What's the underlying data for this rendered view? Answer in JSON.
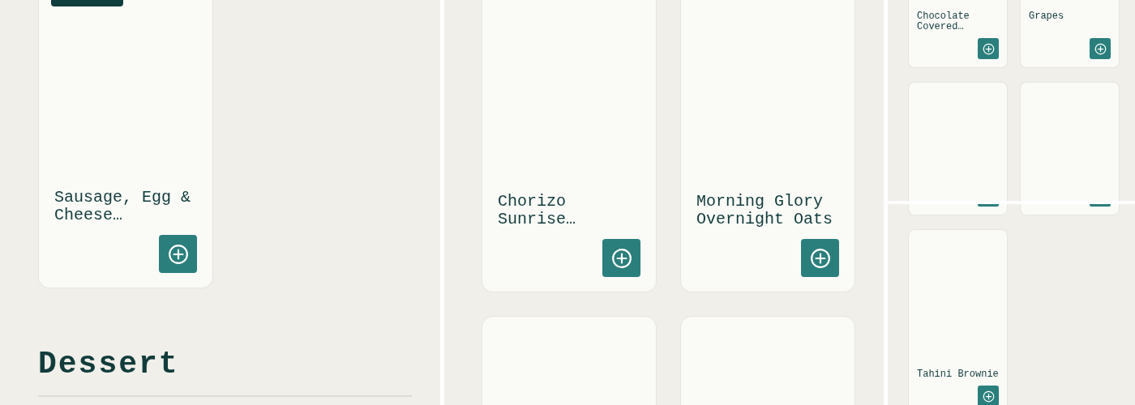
{
  "left_panel": {
    "card_title": "Sausage, Egg & Cheese…",
    "section_heading": "Dessert"
  },
  "middle_panel": {
    "card_titles": [
      "Chorizo Sunrise…",
      "Morning Glory Overnight Oats"
    ]
  },
  "right_panel": {
    "upper_card_titles": [
      "Chocolate Covered…",
      "Grapes"
    ],
    "lower_card_titles": [
      "Tahini Brownie"
    ]
  }
}
